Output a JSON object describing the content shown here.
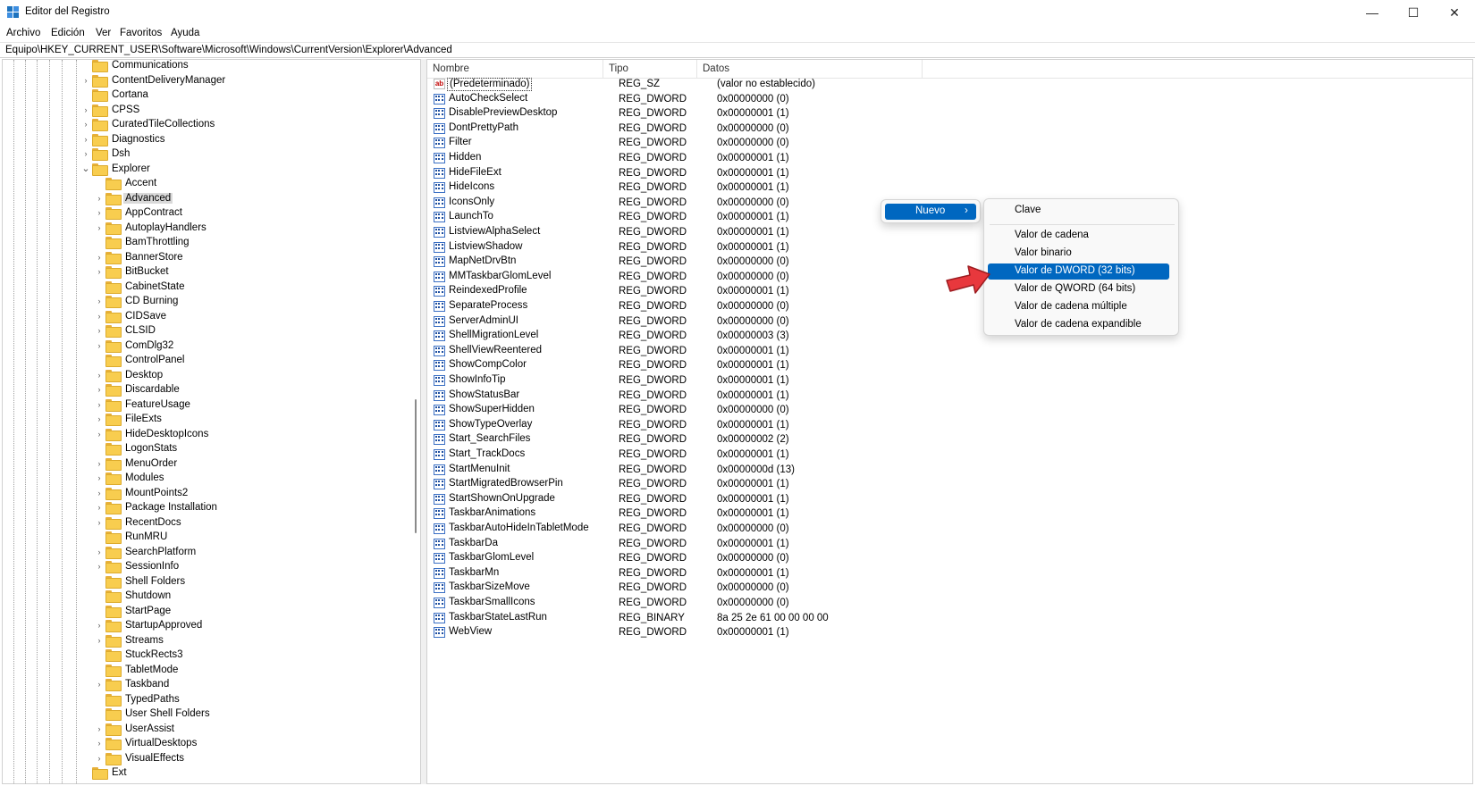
{
  "window": {
    "title": "Editor del Registro",
    "minimize_glyph": "—",
    "maximize_glyph": "☐",
    "close_glyph": "✕"
  },
  "menu": {
    "archivo": "Archivo",
    "edicion": "Edición",
    "ver": "Ver",
    "favoritos": "Favoritos",
    "ayuda": "Ayuda"
  },
  "address": {
    "path": "Equipo\\HKEY_CURRENT_USER\\Software\\Microsoft\\Windows\\CurrentVersion\\Explorer\\Advanced"
  },
  "tree": {
    "top": [
      {
        "label": "Communications",
        "expander": false
      },
      {
        "label": "ContentDeliveryManager",
        "expander": true
      },
      {
        "label": "Cortana",
        "expander": false
      },
      {
        "label": "CPSS",
        "expander": true
      },
      {
        "label": "CuratedTileCollections",
        "expander": true
      },
      {
        "label": "Diagnostics",
        "expander": true
      },
      {
        "label": "Dsh",
        "expander": true
      },
      {
        "label": "Explorer",
        "expander": true,
        "expanded": true
      }
    ],
    "explorer_children": [
      {
        "label": "Accent",
        "expander": false
      },
      {
        "label": "Advanced",
        "expander": true,
        "selected": true
      },
      {
        "label": "AppContract",
        "expander": true
      },
      {
        "label": "AutoplayHandlers",
        "expander": true
      },
      {
        "label": "BamThrottling",
        "expander": false
      },
      {
        "label": "BannerStore",
        "expander": true
      },
      {
        "label": "BitBucket",
        "expander": true
      },
      {
        "label": "CabinetState",
        "expander": false
      },
      {
        "label": "CD Burning",
        "expander": true
      },
      {
        "label": "CIDSave",
        "expander": true
      },
      {
        "label": "CLSID",
        "expander": true
      },
      {
        "label": "ComDlg32",
        "expander": true
      },
      {
        "label": "ControlPanel",
        "expander": false
      },
      {
        "label": "Desktop",
        "expander": true
      },
      {
        "label": "Discardable",
        "expander": true
      },
      {
        "label": "FeatureUsage",
        "expander": true
      },
      {
        "label": "FileExts",
        "expander": true
      },
      {
        "label": "HideDesktopIcons",
        "expander": true
      },
      {
        "label": "LogonStats",
        "expander": false
      },
      {
        "label": "MenuOrder",
        "expander": true
      },
      {
        "label": "Modules",
        "expander": true
      },
      {
        "label": "MountPoints2",
        "expander": true
      },
      {
        "label": "Package Installation",
        "expander": true
      },
      {
        "label": "RecentDocs",
        "expander": true
      },
      {
        "label": "RunMRU",
        "expander": false
      },
      {
        "label": "SearchPlatform",
        "expander": true
      },
      {
        "label": "SessionInfo",
        "expander": true
      },
      {
        "label": "Shell Folders",
        "expander": false
      },
      {
        "label": "Shutdown",
        "expander": false
      },
      {
        "label": "StartPage",
        "expander": false
      },
      {
        "label": "StartupApproved",
        "expander": true
      },
      {
        "label": "Streams",
        "expander": true
      },
      {
        "label": "StuckRects3",
        "expander": false
      },
      {
        "label": "TabletMode",
        "expander": false
      },
      {
        "label": "Taskband",
        "expander": true
      },
      {
        "label": "TypedPaths",
        "expander": false
      },
      {
        "label": "User Shell Folders",
        "expander": false
      },
      {
        "label": "UserAssist",
        "expander": true
      },
      {
        "label": "VirtualDesktops",
        "expander": true
      },
      {
        "label": "VisualEffects",
        "expander": true
      }
    ],
    "bottom": [
      {
        "label": "Ext",
        "expander": false
      }
    ]
  },
  "list": {
    "columns": {
      "nombre": "Nombre",
      "tipo": "Tipo",
      "datos": "Datos"
    },
    "rows": [
      {
        "name": "(Predeterminado)",
        "type": "REG_SZ",
        "data": "(valor no establecido)",
        "icon": "string-value-icon"
      },
      {
        "name": "AutoCheckSelect",
        "type": "REG_DWORD",
        "data": "0x00000000 (0)",
        "icon": "binary-value-icon"
      },
      {
        "name": "DisablePreviewDesktop",
        "type": "REG_DWORD",
        "data": "0x00000001 (1)",
        "icon": "binary-value-icon"
      },
      {
        "name": "DontPrettyPath",
        "type": "REG_DWORD",
        "data": "0x00000000 (0)",
        "icon": "binary-value-icon"
      },
      {
        "name": "Filter",
        "type": "REG_DWORD",
        "data": "0x00000000 (0)",
        "icon": "binary-value-icon"
      },
      {
        "name": "Hidden",
        "type": "REG_DWORD",
        "data": "0x00000001 (1)",
        "icon": "binary-value-icon"
      },
      {
        "name": "HideFileExt",
        "type": "REG_DWORD",
        "data": "0x00000001 (1)",
        "icon": "binary-value-icon"
      },
      {
        "name": "HideIcons",
        "type": "REG_DWORD",
        "data": "0x00000001 (1)",
        "icon": "binary-value-icon"
      },
      {
        "name": "IconsOnly",
        "type": "REG_DWORD",
        "data": "0x00000000 (0)",
        "icon": "binary-value-icon"
      },
      {
        "name": "LaunchTo",
        "type": "REG_DWORD",
        "data": "0x00000001 (1)",
        "icon": "binary-value-icon"
      },
      {
        "name": "ListviewAlphaSelect",
        "type": "REG_DWORD",
        "data": "0x00000001 (1)",
        "icon": "binary-value-icon"
      },
      {
        "name": "ListviewShadow",
        "type": "REG_DWORD",
        "data": "0x00000001 (1)",
        "icon": "binary-value-icon"
      },
      {
        "name": "MapNetDrvBtn",
        "type": "REG_DWORD",
        "data": "0x00000000 (0)",
        "icon": "binary-value-icon"
      },
      {
        "name": "MMTaskbarGlomLevel",
        "type": "REG_DWORD",
        "data": "0x00000000 (0)",
        "icon": "binary-value-icon"
      },
      {
        "name": "ReindexedProfile",
        "type": "REG_DWORD",
        "data": "0x00000001 (1)",
        "icon": "binary-value-icon"
      },
      {
        "name": "SeparateProcess",
        "type": "REG_DWORD",
        "data": "0x00000000 (0)",
        "icon": "binary-value-icon"
      },
      {
        "name": "ServerAdminUI",
        "type": "REG_DWORD",
        "data": "0x00000000 (0)",
        "icon": "binary-value-icon"
      },
      {
        "name": "ShellMigrationLevel",
        "type": "REG_DWORD",
        "data": "0x00000003 (3)",
        "icon": "binary-value-icon"
      },
      {
        "name": "ShellViewReentered",
        "type": "REG_DWORD",
        "data": "0x00000001 (1)",
        "icon": "binary-value-icon"
      },
      {
        "name": "ShowCompColor",
        "type": "REG_DWORD",
        "data": "0x00000001 (1)",
        "icon": "binary-value-icon"
      },
      {
        "name": "ShowInfoTip",
        "type": "REG_DWORD",
        "data": "0x00000001 (1)",
        "icon": "binary-value-icon"
      },
      {
        "name": "ShowStatusBar",
        "type": "REG_DWORD",
        "data": "0x00000001 (1)",
        "icon": "binary-value-icon"
      },
      {
        "name": "ShowSuperHidden",
        "type": "REG_DWORD",
        "data": "0x00000000 (0)",
        "icon": "binary-value-icon"
      },
      {
        "name": "ShowTypeOverlay",
        "type": "REG_DWORD",
        "data": "0x00000001 (1)",
        "icon": "binary-value-icon"
      },
      {
        "name": "Start_SearchFiles",
        "type": "REG_DWORD",
        "data": "0x00000002 (2)",
        "icon": "binary-value-icon"
      },
      {
        "name": "Start_TrackDocs",
        "type": "REG_DWORD",
        "data": "0x00000001 (1)",
        "icon": "binary-value-icon"
      },
      {
        "name": "StartMenuInit",
        "type": "REG_DWORD",
        "data": "0x0000000d (13)",
        "icon": "binary-value-icon"
      },
      {
        "name": "StartMigratedBrowserPin",
        "type": "REG_DWORD",
        "data": "0x00000001 (1)",
        "icon": "binary-value-icon"
      },
      {
        "name": "StartShownOnUpgrade",
        "type": "REG_DWORD",
        "data": "0x00000001 (1)",
        "icon": "binary-value-icon"
      },
      {
        "name": "TaskbarAnimations",
        "type": "REG_DWORD",
        "data": "0x00000001 (1)",
        "icon": "binary-value-icon"
      },
      {
        "name": "TaskbarAutoHideInTabletMode",
        "type": "REG_DWORD",
        "data": "0x00000000 (0)",
        "icon": "binary-value-icon"
      },
      {
        "name": "TaskbarDa",
        "type": "REG_DWORD",
        "data": "0x00000001 (1)",
        "icon": "binary-value-icon"
      },
      {
        "name": "TaskbarGlomLevel",
        "type": "REG_DWORD",
        "data": "0x00000000 (0)",
        "icon": "binary-value-icon"
      },
      {
        "name": "TaskbarMn",
        "type": "REG_DWORD",
        "data": "0x00000001 (1)",
        "icon": "binary-value-icon"
      },
      {
        "name": "TaskbarSizeMove",
        "type": "REG_DWORD",
        "data": "0x00000000 (0)",
        "icon": "binary-value-icon"
      },
      {
        "name": "TaskbarSmallIcons",
        "type": "REG_DWORD",
        "data": "0x00000000 (0)",
        "icon": "binary-value-icon"
      },
      {
        "name": "TaskbarStateLastRun",
        "type": "REG_BINARY",
        "data": "8a 25 2e 61 00 00 00 00",
        "icon": "binary-value-icon"
      },
      {
        "name": "WebView",
        "type": "REG_DWORD",
        "data": "0x00000001 (1)",
        "icon": "binary-value-icon"
      }
    ]
  },
  "context_menu": {
    "nuevo": "Nuevo",
    "nuevo_arrow": "›"
  },
  "submenu": {
    "clave": "Clave",
    "cadena": "Valor de cadena",
    "binario": "Valor binario",
    "dword": "Valor de DWORD (32 bits)",
    "qword": "Valor de QWORD (64 bits)",
    "cadena_multiple": "Valor de cadena múltiple",
    "cadena_expandible": "Valor de cadena expandible"
  },
  "colors": {
    "highlight": "#0067c0",
    "folder": "#f8cd4f",
    "pointer_arrow": "#e8383d"
  }
}
